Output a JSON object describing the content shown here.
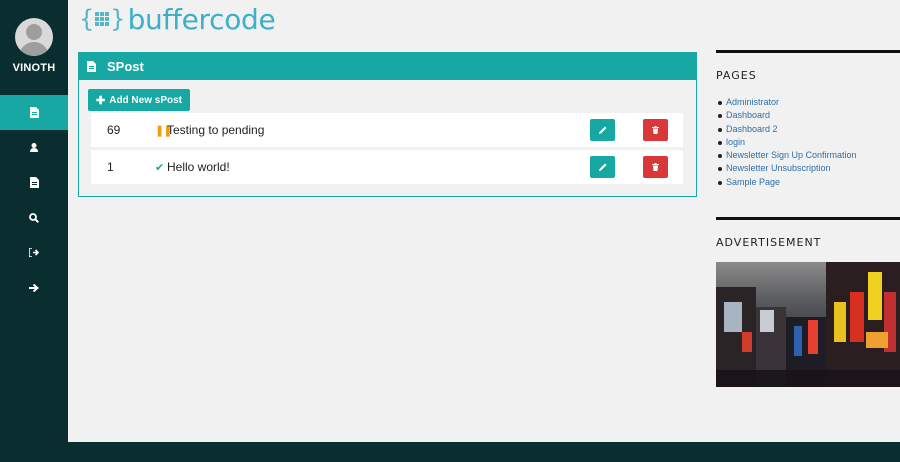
{
  "user": {
    "name": "VINOTH"
  },
  "nav": [
    {
      "icon": "file-icon",
      "glyph": "▤",
      "active": true
    },
    {
      "icon": "user-icon",
      "glyph": "●",
      "active": false
    },
    {
      "icon": "document-icon",
      "glyph": "▤",
      "active": false
    },
    {
      "icon": "search-icon",
      "glyph": "⚲",
      "active": false
    },
    {
      "icon": "sign-out-icon",
      "glyph": "⇥",
      "active": false
    },
    {
      "icon": "arrow-right-icon",
      "glyph": "➔",
      "active": false
    }
  ],
  "logo": {
    "text": "buffercode"
  },
  "panel": {
    "title": "SPost",
    "add_button": "Add New sPost",
    "rows": [
      {
        "id": "69",
        "status": "pending",
        "status_glyph": "❚❚",
        "title": "Testing to pending"
      },
      {
        "id": "1",
        "status": "published",
        "status_glyph": "✔",
        "title": "Hello world!"
      }
    ]
  },
  "sidebar_right": {
    "pages_title": "PAGES",
    "pages": [
      "Administrator",
      "Dashboard",
      "Dashboard 2",
      "login",
      "Newsletter Sign Up Confirmation",
      "Newsletter Unsubscription",
      "Sample Page"
    ],
    "ad_title": "ADVERTISEMENT"
  },
  "colors": {
    "accent": "#17a8a3",
    "sidebar": "#0a2d2f",
    "danger": "#d9383a",
    "pending": "#f39c12",
    "link": "#2d6fa8"
  }
}
